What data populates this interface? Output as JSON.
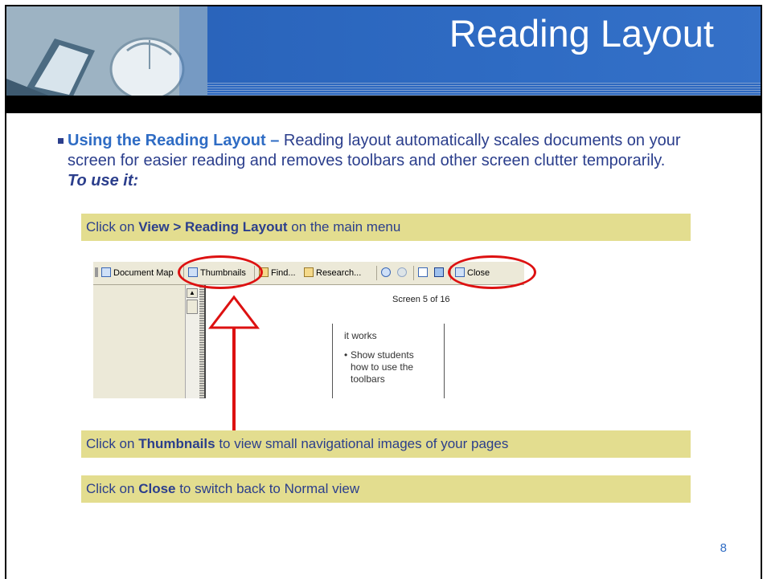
{
  "slide": {
    "title": "Reading Layout",
    "page_number": "8"
  },
  "bullet": {
    "lead": "Using the Reading Layout –",
    "body": " Reading layout automatically scales documents on your screen for easier reading and removes toolbars and other screen clutter temporarily. ",
    "tail": "To use it:"
  },
  "notes": {
    "view": {
      "pre": "Click on ",
      "bold": "View > Reading Layout",
      "post": " on the main menu"
    },
    "thumbnails": {
      "pre": "Click on ",
      "bold": "Thumbnails",
      "post": " to view small navigational images of your pages"
    },
    "close": {
      "pre": "Click on ",
      "bold": "Close",
      "post": " to switch back to Normal view"
    }
  },
  "screenshot": {
    "toolbar": {
      "document_map": "Document Map",
      "thumbnails": "Thumbnails",
      "find": "Find...",
      "research": "Research...",
      "close": "Close"
    },
    "screen_count": "Screen 5 of 16",
    "doc_line1": "it works",
    "doc_bullet": "Show students how to use the toolbars"
  },
  "colors": {
    "header_blue": "#2f6cc4",
    "note_bar": "#e3dd8f",
    "text_navy": "#2b3e8c",
    "annotation_red": "#dd1111"
  }
}
